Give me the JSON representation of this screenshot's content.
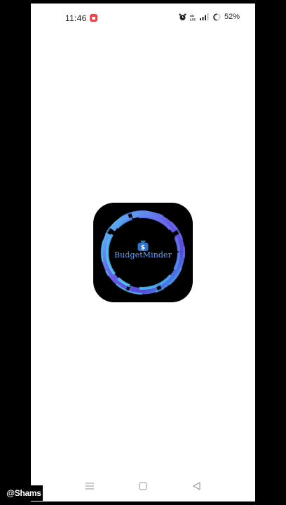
{
  "status_bar": {
    "time": "11:46",
    "notification_icon": "screen-record-icon",
    "alarm_icon": "alarm-icon",
    "network_icon": "volte-icon",
    "signal_icon": "cellular-signal-icon",
    "battery_icon": "battery-ring-icon",
    "battery_level": "52%"
  },
  "splash": {
    "app_name": "BudgetMinder",
    "logo_icon": "money-bag-dollar-icon",
    "logo_background": "#000000",
    "ring_colors": [
      "#4fc3f7",
      "#6a5cf0",
      "#3aa0ff"
    ]
  },
  "nav_bar": {
    "recent_icon": "recent-apps-icon",
    "home_icon": "home-icon",
    "back_icon": "back-icon"
  },
  "watermark": {
    "text": "@Shams"
  }
}
